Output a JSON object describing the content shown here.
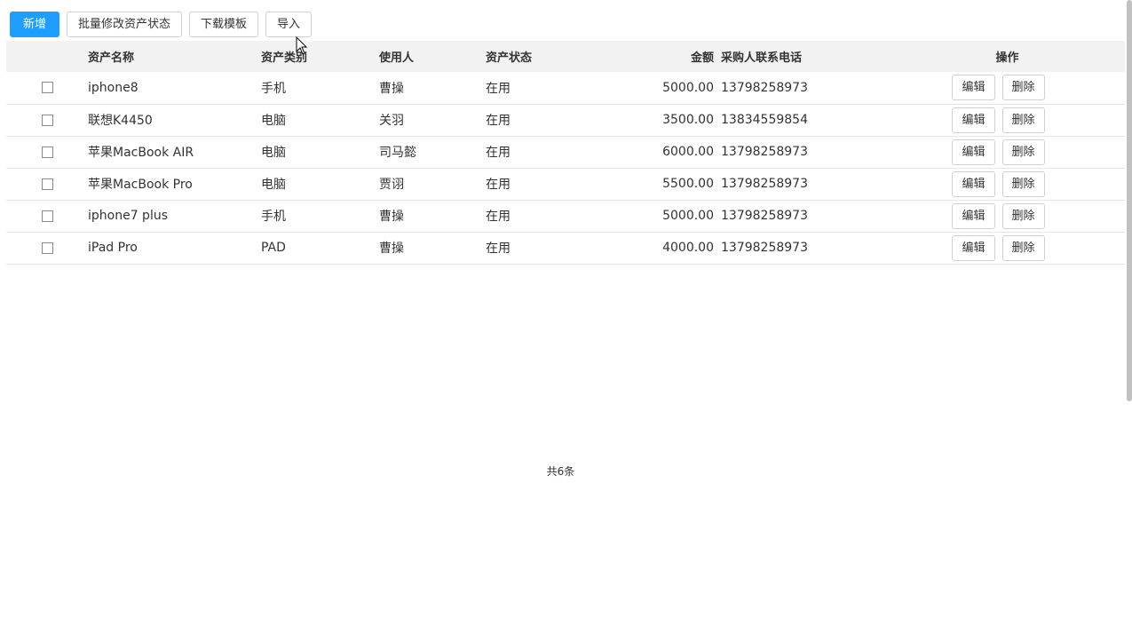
{
  "toolbar": {
    "add_label": "新增",
    "batch_label": "批量修改资产状态",
    "download_label": "下载模板",
    "import_label": "导入"
  },
  "table": {
    "headers": {
      "name": "资产名称",
      "type": "资产类别",
      "user": "使用人",
      "status": "资产状态",
      "amount": "金额",
      "phone": "采购人联系电话",
      "ops": "操作"
    },
    "edit_label": "编辑",
    "delete_label": "删除",
    "rows": [
      {
        "name": "iphone8",
        "type": "手机",
        "user": "曹操",
        "status": "在用",
        "amount": "5000.00",
        "phone": "13798258973"
      },
      {
        "name": "联想K4450",
        "type": "电脑",
        "user": "关羽",
        "status": "在用",
        "amount": "3500.00",
        "phone": "13834559854"
      },
      {
        "name": "苹果MacBook AIR",
        "type": "电脑",
        "user": "司马懿",
        "status": "在用",
        "amount": "6000.00",
        "phone": "13798258973"
      },
      {
        "name": "苹果MacBook Pro",
        "type": "电脑",
        "user": "贾诩",
        "status": "在用",
        "amount": "5500.00",
        "phone": "13798258973"
      },
      {
        "name": "iphone7 plus",
        "type": "手机",
        "user": "曹操",
        "status": "在用",
        "amount": "5000.00",
        "phone": "13798258973"
      },
      {
        "name": "iPad Pro",
        "type": "PAD",
        "user": "曹操",
        "status": "在用",
        "amount": "4000.00",
        "phone": "13798258973"
      }
    ]
  },
  "pager": {
    "total_label": "共6条"
  }
}
